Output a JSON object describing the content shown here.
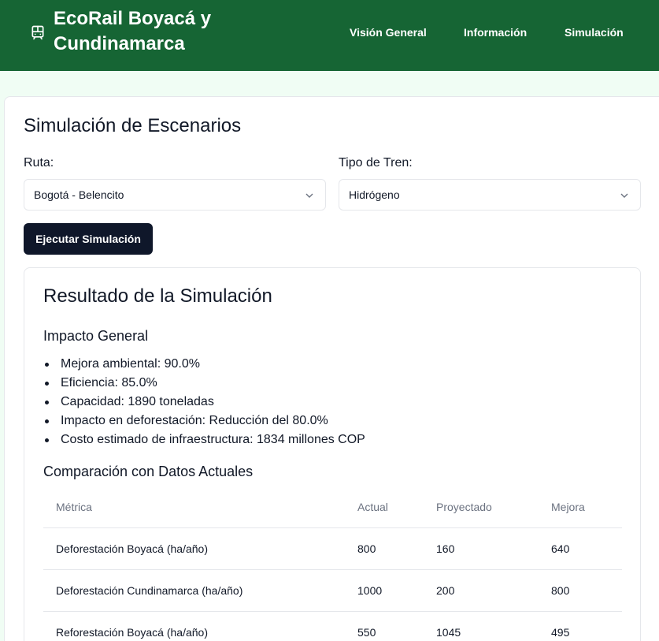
{
  "header": {
    "brand": "EcoRail Boyacá y Cundinamarca",
    "brand_icon": "train-icon",
    "nav": [
      "Visión General",
      "Información",
      "Simulación"
    ]
  },
  "main": {
    "title": "Simulación de Escenarios",
    "route_label": "Ruta:",
    "route_value": "Bogotá - Belencito",
    "train_label": "Tipo de Tren:",
    "train_value": "Hidrógeno",
    "run_button": "Ejecutar Simulación"
  },
  "result": {
    "title": "Resultado de la Simulación",
    "impact_heading": "Impacto General",
    "impact_items": [
      "Mejora ambiental: 90.0%",
      "Eficiencia: 85.0%",
      "Capacidad: 1890 toneladas",
      "Impacto en deforestación: Reducción del 80.0%",
      "Costo estimado de infraestructura: 1834 millones COP"
    ],
    "comparison_heading": "Comparación con Datos Actuales",
    "table": {
      "headers": [
        "Métrica",
        "Actual",
        "Proyectado",
        "Mejora"
      ],
      "rows": [
        [
          "Deforestación Boyacá (ha/año)",
          "800",
          "160",
          "640"
        ],
        [
          "Deforestación Cundinamarca (ha/año)",
          "1000",
          "200",
          "800"
        ],
        [
          "Reforestación Boyacá (ha/año)",
          "550",
          "1045",
          "495"
        ]
      ]
    }
  },
  "colors": {
    "header_bg": "#166534",
    "button_bg": "#0f172a",
    "page_bg": "#f0fdf4"
  }
}
